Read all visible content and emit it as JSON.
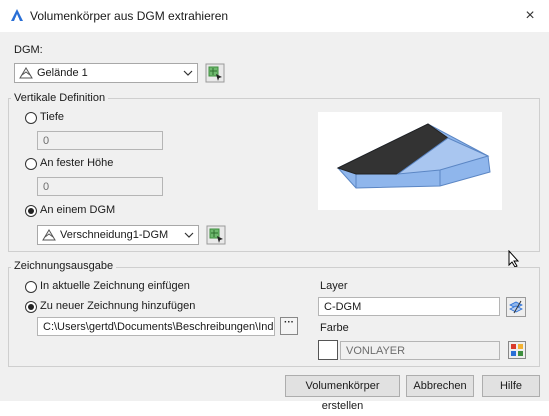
{
  "window": {
    "title": "Volumenkörper aus DGM extrahieren",
    "close_glyph": "×"
  },
  "dgm": {
    "label": "DGM:",
    "selected": "Gelände 1"
  },
  "vertical": {
    "title": "Vertikale Definition",
    "options": [
      {
        "label": "Tiefe",
        "selected": false,
        "value": "0"
      },
      {
        "label": "An fester Höhe",
        "selected": false,
        "value": "0"
      },
      {
        "label": "An einem DGM",
        "selected": true,
        "value": "Verschneidung1-DGM"
      }
    ]
  },
  "output": {
    "title": "Zeichnungsausgabe",
    "options": [
      {
        "label": "In aktuelle Zeichnung einfügen",
        "selected": false
      },
      {
        "label": "Zu neuer Zeichnung hinzufügen",
        "selected": true
      }
    ],
    "path": "C:\\Users\\gertd\\Documents\\Beschreibungen\\Individu",
    "browse_glyph": "···",
    "layer_label": "Layer",
    "layer_value": "C-DGM",
    "color_label": "Farbe",
    "color_value": "VONLAYER"
  },
  "buttons": {
    "create": "Volumenkörper erstellen",
    "cancel": "Abbrechen",
    "help": "Hilfe"
  },
  "colors": {
    "accent_blue": "#2a6fd6",
    "solid_fill": "#8fb6ec",
    "solid_top": "#3a3a3a",
    "pick_green": "#3f8f3f"
  }
}
